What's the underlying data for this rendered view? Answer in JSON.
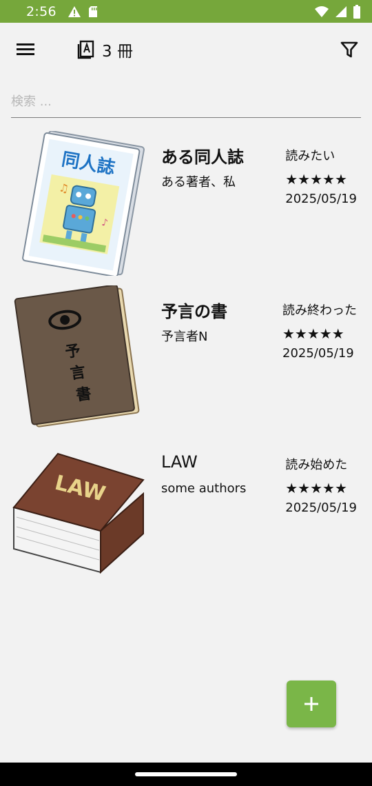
{
  "status_bar": {
    "time": "2:56",
    "left_icons": [
      "warning-icon",
      "sd-card-icon"
    ],
    "right_icons": [
      "wifi-icon",
      "signal-icon",
      "battery-icon"
    ]
  },
  "app_bar": {
    "count_label": "3 冊",
    "icons": [
      "menu-icon",
      "book-count-icon",
      "filter-icon"
    ]
  },
  "search": {
    "placeholder": "検索 ..."
  },
  "books": [
    {
      "title": "ある同人誌",
      "author": "ある著者、私",
      "status": "読みたい",
      "stars": "★★★★★",
      "date": "2025/05/19",
      "cover_text": "同人誌"
    },
    {
      "title": "予言の書",
      "author": "予言者N",
      "status": "読み終わった",
      "stars": "★★★★★",
      "date": "2025/05/19",
      "cover_text": "予言書"
    },
    {
      "title": "LAW",
      "author": "some authors",
      "status": "読み始めた",
      "stars": "★★★★★",
      "date": "2025/05/19",
      "cover_text": "LAW"
    }
  ],
  "colors": {
    "status_bar": "#76a73b",
    "fab": "#7ab648"
  }
}
